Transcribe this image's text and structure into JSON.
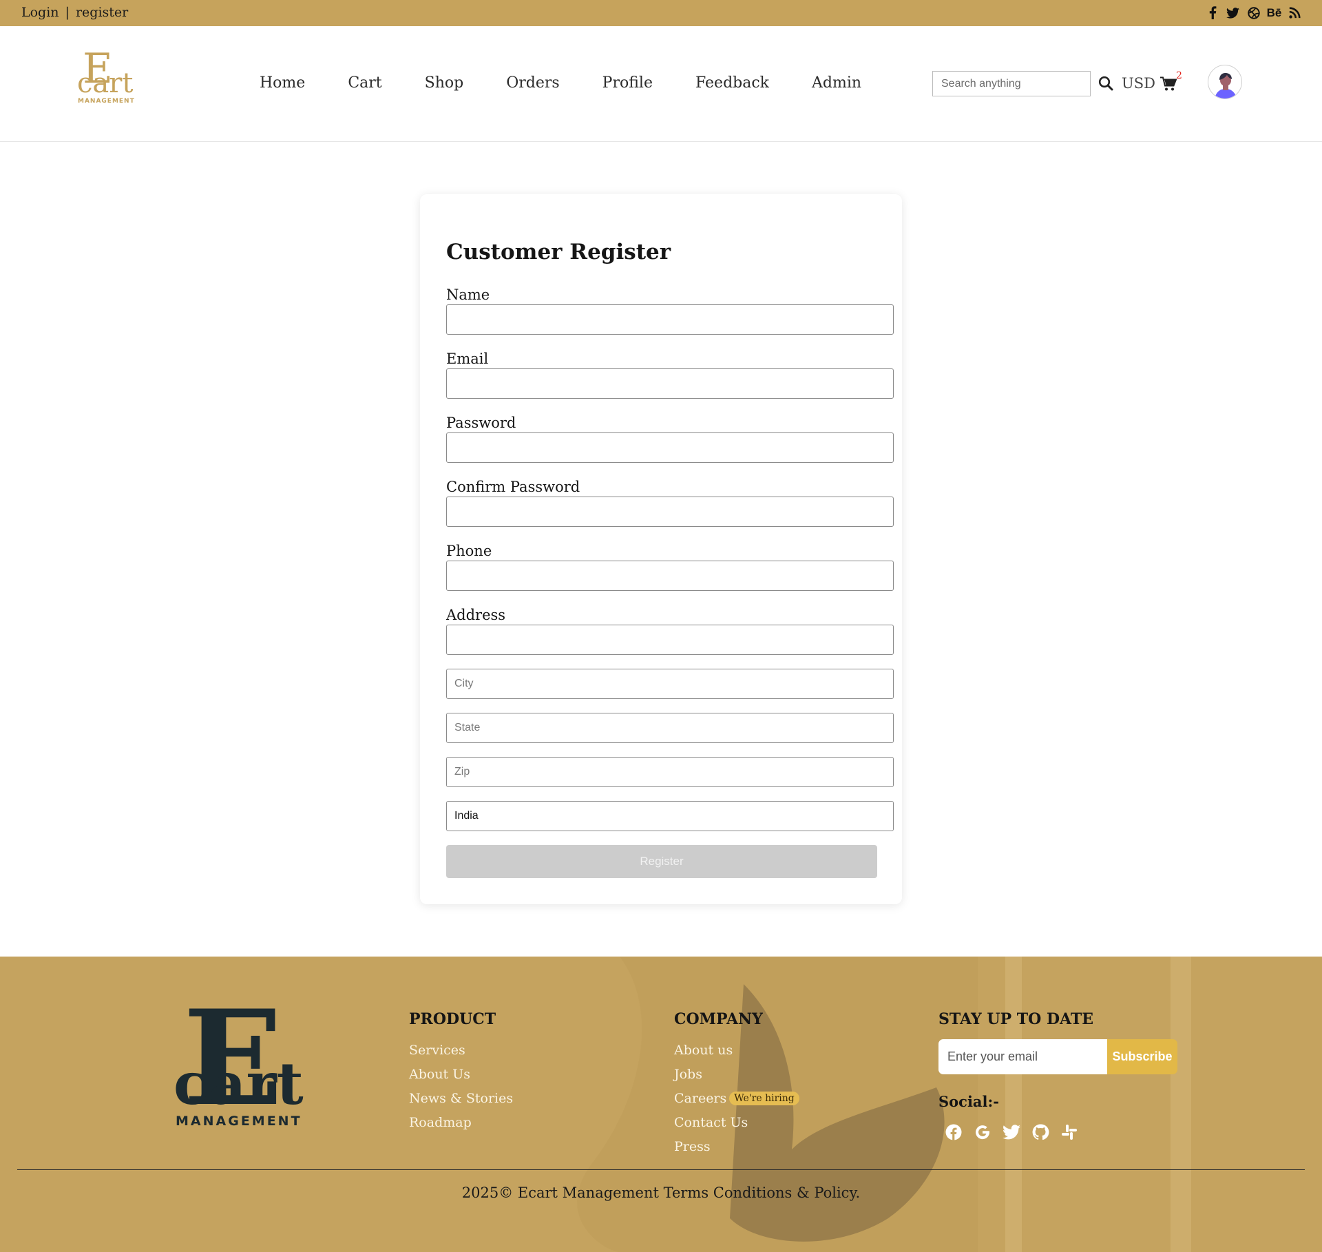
{
  "topbar": {
    "login": "Login",
    "separator": "|",
    "register": "register",
    "social_icons": [
      "facebook-icon",
      "twitter-icon",
      "dribbble-icon",
      "behance-icon",
      "rss-icon"
    ],
    "behance_text": "Bē"
  },
  "header": {
    "logo": {
      "letter": "E",
      "word": "cart",
      "tagline": "MANAGEMENT"
    },
    "nav": [
      "Home",
      "Cart",
      "Shop",
      "Orders",
      "Profile",
      "Feedback",
      "Admin"
    ],
    "search_placeholder": "Search anything",
    "currency": "USD",
    "cart_count": "2"
  },
  "form": {
    "title": "Customer Register",
    "labels": {
      "name": "Name",
      "email": "Email",
      "password": "Password",
      "confirm_password": "Confirm Password",
      "phone": "Phone",
      "address": "Address"
    },
    "placeholders": {
      "city": "City",
      "state": "State",
      "zip": "Zip"
    },
    "country_value": "India",
    "submit": "Register"
  },
  "footer": {
    "logo": {
      "letter": "E",
      "word": "cart",
      "tagline": "MANAGEMENT"
    },
    "product": {
      "heading": "PRODUCT",
      "links": [
        "Services",
        "About Us",
        "News & Stories",
        "Roadmap"
      ]
    },
    "company": {
      "heading": "COMPANY",
      "links": [
        "About us",
        "Jobs",
        "Careers",
        "Contact Us",
        "Press"
      ],
      "hiring_badge": "We're hiring"
    },
    "newsletter": {
      "heading": "STAY UP TO DATE",
      "placeholder": "Enter your email",
      "button": "Subscribe"
    },
    "social_heading": "Social:-",
    "social_icons": [
      "facebook-icon",
      "google-icon",
      "twitter-icon",
      "github-icon",
      "slack-icon"
    ],
    "copyright": "2025© Ecart Management Terms Conditions & Policy."
  },
  "colors": {
    "brand_gold": "#c6a35c",
    "footer_bg": "#c5a35f",
    "badge": "#e6bd52",
    "subscribe": "#e2b847",
    "cart_count": "#e0211a"
  }
}
